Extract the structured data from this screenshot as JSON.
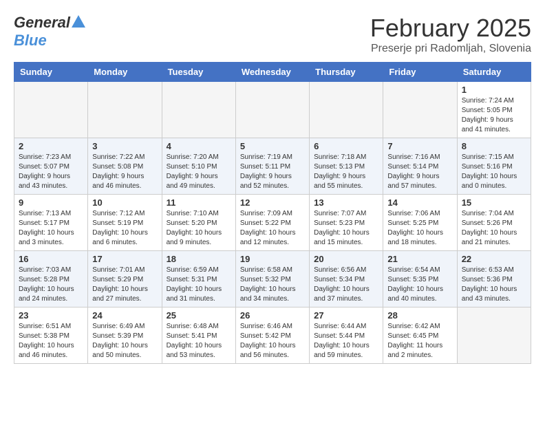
{
  "header": {
    "logo_general": "General",
    "logo_blue": "Blue",
    "month_title": "February 2025",
    "subtitle": "Preserje pri Radomljah, Slovenia"
  },
  "weekdays": [
    "Sunday",
    "Monday",
    "Tuesday",
    "Wednesday",
    "Thursday",
    "Friday",
    "Saturday"
  ],
  "weeks": [
    {
      "shaded": false,
      "days": [
        {
          "num": "",
          "info": ""
        },
        {
          "num": "",
          "info": ""
        },
        {
          "num": "",
          "info": ""
        },
        {
          "num": "",
          "info": ""
        },
        {
          "num": "",
          "info": ""
        },
        {
          "num": "",
          "info": ""
        },
        {
          "num": "1",
          "info": "Sunrise: 7:24 AM\nSunset: 5:05 PM\nDaylight: 9 hours\nand 41 minutes."
        }
      ]
    },
    {
      "shaded": true,
      "days": [
        {
          "num": "2",
          "info": "Sunrise: 7:23 AM\nSunset: 5:07 PM\nDaylight: 9 hours\nand 43 minutes."
        },
        {
          "num": "3",
          "info": "Sunrise: 7:22 AM\nSunset: 5:08 PM\nDaylight: 9 hours\nand 46 minutes."
        },
        {
          "num": "4",
          "info": "Sunrise: 7:20 AM\nSunset: 5:10 PM\nDaylight: 9 hours\nand 49 minutes."
        },
        {
          "num": "5",
          "info": "Sunrise: 7:19 AM\nSunset: 5:11 PM\nDaylight: 9 hours\nand 52 minutes."
        },
        {
          "num": "6",
          "info": "Sunrise: 7:18 AM\nSunset: 5:13 PM\nDaylight: 9 hours\nand 55 minutes."
        },
        {
          "num": "7",
          "info": "Sunrise: 7:16 AM\nSunset: 5:14 PM\nDaylight: 9 hours\nand 57 minutes."
        },
        {
          "num": "8",
          "info": "Sunrise: 7:15 AM\nSunset: 5:16 PM\nDaylight: 10 hours\nand 0 minutes."
        }
      ]
    },
    {
      "shaded": false,
      "days": [
        {
          "num": "9",
          "info": "Sunrise: 7:13 AM\nSunset: 5:17 PM\nDaylight: 10 hours\nand 3 minutes."
        },
        {
          "num": "10",
          "info": "Sunrise: 7:12 AM\nSunset: 5:19 PM\nDaylight: 10 hours\nand 6 minutes."
        },
        {
          "num": "11",
          "info": "Sunrise: 7:10 AM\nSunset: 5:20 PM\nDaylight: 10 hours\nand 9 minutes."
        },
        {
          "num": "12",
          "info": "Sunrise: 7:09 AM\nSunset: 5:22 PM\nDaylight: 10 hours\nand 12 minutes."
        },
        {
          "num": "13",
          "info": "Sunrise: 7:07 AM\nSunset: 5:23 PM\nDaylight: 10 hours\nand 15 minutes."
        },
        {
          "num": "14",
          "info": "Sunrise: 7:06 AM\nSunset: 5:25 PM\nDaylight: 10 hours\nand 18 minutes."
        },
        {
          "num": "15",
          "info": "Sunrise: 7:04 AM\nSunset: 5:26 PM\nDaylight: 10 hours\nand 21 minutes."
        }
      ]
    },
    {
      "shaded": true,
      "days": [
        {
          "num": "16",
          "info": "Sunrise: 7:03 AM\nSunset: 5:28 PM\nDaylight: 10 hours\nand 24 minutes."
        },
        {
          "num": "17",
          "info": "Sunrise: 7:01 AM\nSunset: 5:29 PM\nDaylight: 10 hours\nand 27 minutes."
        },
        {
          "num": "18",
          "info": "Sunrise: 6:59 AM\nSunset: 5:31 PM\nDaylight: 10 hours\nand 31 minutes."
        },
        {
          "num": "19",
          "info": "Sunrise: 6:58 AM\nSunset: 5:32 PM\nDaylight: 10 hours\nand 34 minutes."
        },
        {
          "num": "20",
          "info": "Sunrise: 6:56 AM\nSunset: 5:34 PM\nDaylight: 10 hours\nand 37 minutes."
        },
        {
          "num": "21",
          "info": "Sunrise: 6:54 AM\nSunset: 5:35 PM\nDaylight: 10 hours\nand 40 minutes."
        },
        {
          "num": "22",
          "info": "Sunrise: 6:53 AM\nSunset: 5:36 PM\nDaylight: 10 hours\nand 43 minutes."
        }
      ]
    },
    {
      "shaded": false,
      "days": [
        {
          "num": "23",
          "info": "Sunrise: 6:51 AM\nSunset: 5:38 PM\nDaylight: 10 hours\nand 46 minutes."
        },
        {
          "num": "24",
          "info": "Sunrise: 6:49 AM\nSunset: 5:39 PM\nDaylight: 10 hours\nand 50 minutes."
        },
        {
          "num": "25",
          "info": "Sunrise: 6:48 AM\nSunset: 5:41 PM\nDaylight: 10 hours\nand 53 minutes."
        },
        {
          "num": "26",
          "info": "Sunrise: 6:46 AM\nSunset: 5:42 PM\nDaylight: 10 hours\nand 56 minutes."
        },
        {
          "num": "27",
          "info": "Sunrise: 6:44 AM\nSunset: 5:44 PM\nDaylight: 10 hours\nand 59 minutes."
        },
        {
          "num": "28",
          "info": "Sunrise: 6:42 AM\nSunset: 6:45 PM\nDaylight: 11 hours\nand 2 minutes."
        },
        {
          "num": "",
          "info": ""
        }
      ]
    }
  ]
}
